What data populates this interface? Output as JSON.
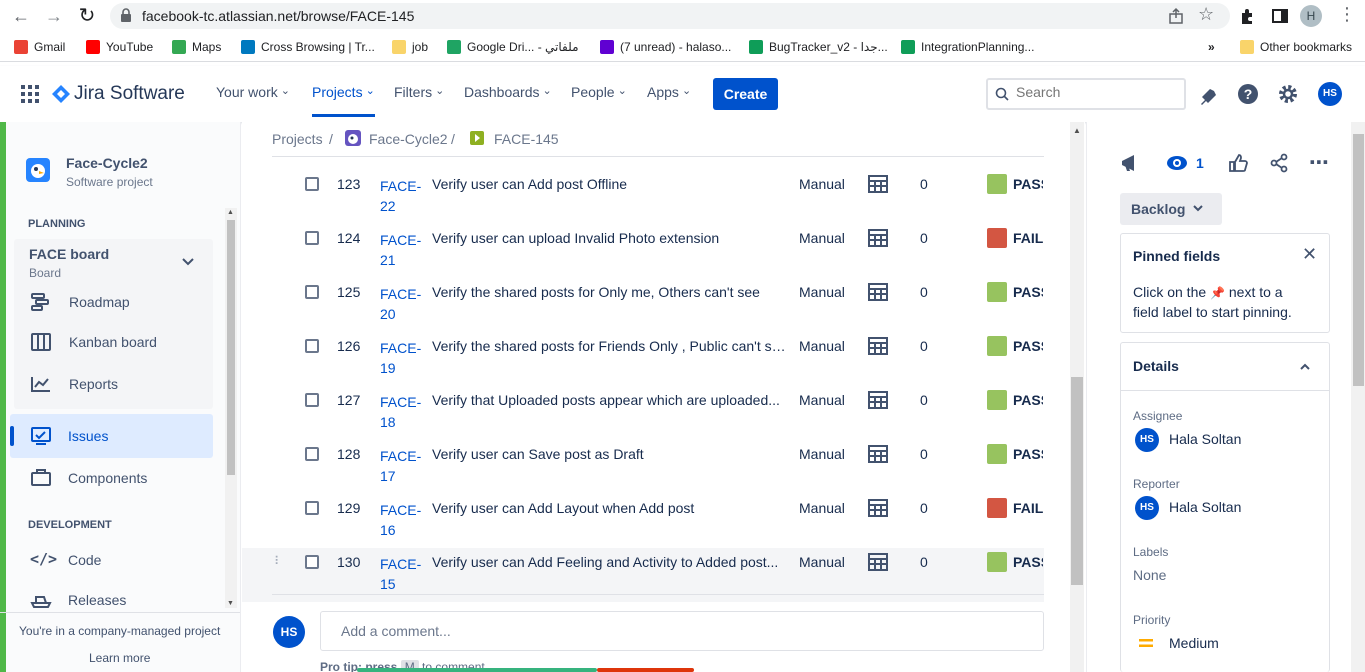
{
  "browser": {
    "url": "facebook-tc.atlassian.net/browse/FACE-145",
    "profile_initial": "H",
    "bookmarks": [
      {
        "label": "Gmail",
        "color": "#ea4335"
      },
      {
        "label": "YouTube",
        "color": "#ff0000"
      },
      {
        "label": "Maps",
        "color": "#34a853"
      },
      {
        "label": "Cross Browsing | Tr...",
        "color": "#0079bf"
      },
      {
        "label": "job",
        "color": "#f9d46a"
      },
      {
        "label": "Google Dri... - ملفاتي",
        "color": "#1fa463"
      },
      {
        "label": "(7 unread) - halaso...",
        "color": "#6001d2"
      },
      {
        "label": "BugTracker_v2 - جدا...",
        "color": "#0f9d58"
      },
      {
        "label": "IntegrationPlanning...",
        "color": "#0f9d58"
      }
    ],
    "more_bookmarks": "»",
    "other_bookmarks": "Other bookmarks"
  },
  "header": {
    "logo": "Jira Software",
    "nav": [
      {
        "label": "Your work",
        "active": false
      },
      {
        "label": "Projects",
        "active": true
      },
      {
        "label": "Filters",
        "active": false
      },
      {
        "label": "Dashboards",
        "active": false
      },
      {
        "label": "People",
        "active": false
      },
      {
        "label": "Apps",
        "active": false
      }
    ],
    "create": "Create",
    "search_placeholder": "Search",
    "user_initials": "HS",
    "accent": "#0052cc"
  },
  "sidebar": {
    "project_name": "Face-Cycle2",
    "project_type": "Software project",
    "planning_label": "PLANNING",
    "board_name": "FACE board",
    "board_sub": "Board",
    "planning_items": [
      "Roadmap",
      "Kanban board",
      "Reports"
    ],
    "issues": "Issues",
    "components": "Components",
    "development_label": "DEVELOPMENT",
    "dev_items": [
      "Code",
      "Releases"
    ],
    "footer_text": "You're in a company-managed project",
    "learn_more": "Learn more"
  },
  "breadcrumb": {
    "projects": "Projects",
    "project": "Face-Cycle2",
    "issue": "FACE-145"
  },
  "rows": [
    {
      "num": "123",
      "key": [
        "FACE-",
        "22"
      ],
      "summary": "Verify user can Add post Offline",
      "type": "Manual",
      "count": "0",
      "status": "PASS",
      "color": "#97c35f"
    },
    {
      "num": "124",
      "key": [
        "FACE-",
        "21"
      ],
      "summary": "Verify user can upload Invalid Photo extension",
      "type": "Manual",
      "count": "0",
      "status": "FAIL",
      "color": "#d35642"
    },
    {
      "num": "125",
      "key": [
        "FACE-",
        "20"
      ],
      "summary": "Verify the shared posts for Only me, Others can't see",
      "type": "Manual",
      "count": "0",
      "status": "PASS",
      "color": "#97c35f"
    },
    {
      "num": "126",
      "key": [
        "FACE-",
        "19"
      ],
      "summary": "Verify the shared posts for Friends Only , Public can't see",
      "type": "Manual",
      "count": "0",
      "status": "PASS",
      "color": "#97c35f"
    },
    {
      "num": "127",
      "key": [
        "FACE-",
        "18"
      ],
      "summary": "Verify that Uploaded posts appear which are uploaded...",
      "type": "Manual",
      "count": "0",
      "status": "PASS",
      "color": "#97c35f"
    },
    {
      "num": "128",
      "key": [
        "FACE-",
        "17"
      ],
      "summary": "Verify user can Save post as Draft",
      "type": "Manual",
      "count": "0",
      "status": "PASS",
      "color": "#97c35f"
    },
    {
      "num": "129",
      "key": [
        "FACE-",
        "16"
      ],
      "summary": "Verify user can Add Layout when Add post",
      "type": "Manual",
      "count": "0",
      "status": "FAIL",
      "color": "#d35642"
    },
    {
      "num": "130",
      "key": [
        "FACE-",
        "15"
      ],
      "summary": "Verify user can Add Feeling and Activity to Added post...",
      "type": "Manual",
      "count": "0",
      "status": "PASS",
      "color": "#97c35f"
    }
  ],
  "comment": {
    "avatar": "HS",
    "placeholder": "Add a comment...",
    "protip": "Pro tip: press",
    "protip_key": "M",
    "protip_tail": "to comment"
  },
  "panel": {
    "watch_count": "1",
    "status": "Backlog",
    "pinned_title": "Pinned fields",
    "pinned_text_a": "Click on the",
    "pinned_text_b": "next to a",
    "pinned_text_c": "field label to start pinning.",
    "details": "Details",
    "assignee_label": "Assignee",
    "assignee": "Hala Soltan",
    "reporter_label": "Reporter",
    "reporter": "Hala Soltan",
    "labels_label": "Labels",
    "labels": "None",
    "priority_label": "Priority",
    "priority": "Medium"
  }
}
